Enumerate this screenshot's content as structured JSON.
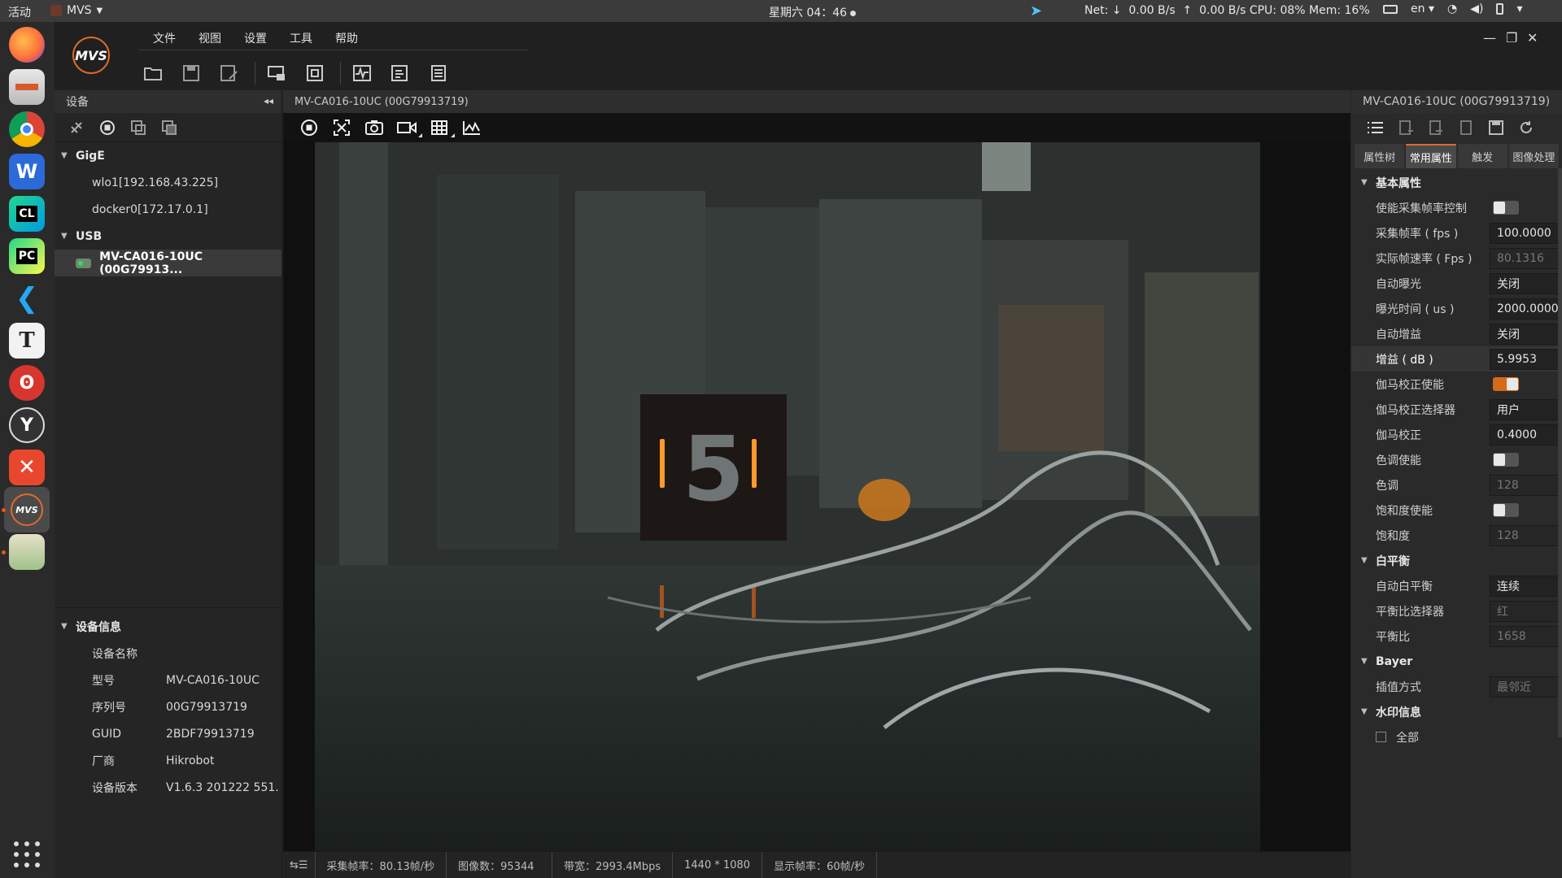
{
  "topbar": {
    "activities": "活动",
    "app_name": "MVS",
    "clock": "星期六 04：46",
    "net": "Net: ↓  0.00 B/s  ↑  0.00 B/s CPU: 08% Mem: 16%",
    "lang": "en"
  },
  "menu": [
    "文件",
    "视图",
    "设置",
    "工具",
    "帮助"
  ],
  "logo_text": "MVS",
  "left": {
    "title": "设备",
    "gige_label": "GigE",
    "gige_items": [
      "wlo1[192.168.43.225]",
      "docker0[172.17.0.1]"
    ],
    "usb_label": "USB",
    "usb_device": "MV-CA016-10UC (00G79913...",
    "info_title": "设备信息",
    "info": {
      "name_k": "设备名称",
      "model_k": "型号",
      "model_v": "MV-CA016-10UC",
      "serial_k": "序列号",
      "serial_v": "00G79913719",
      "guid_k": "GUID",
      "guid_v": "2BDF79913719",
      "vendor_k": "厂商",
      "vendor_v": "Hikrobot",
      "version_k": "设备版本",
      "version_v": "V1.6.3 201222 551..."
    }
  },
  "viewer": {
    "title": "MV-CA016-10UC (00G79913719)",
    "status": {
      "capture_fps": "采集帧率：80.13帧/秒",
      "image_count": "图像数：95344",
      "bandwidth": "带宽：2993.4Mbps",
      "resolution": "1440 * 1080",
      "display_fps": "显示帧率：60帧/秒"
    },
    "scene_digit": "5"
  },
  "right": {
    "title": "MV-CA016-10UC (00G79913719)",
    "tabs": [
      "属性树",
      "常用属性",
      "触发",
      "图像处理"
    ],
    "sec_basic": "基本属性",
    "sec_wb": "白平衡",
    "sec_bayer": "Bayer",
    "sec_wm": "水印信息",
    "p": {
      "fr_enable": "使能采集帧率控制",
      "fr": "采集帧率 ( fps )",
      "fr_v": "100.0000",
      "afr": "实际帧速率 ( Fps )",
      "afr_v": "80.1316",
      "ae": "自动曝光",
      "ae_v": "关闭",
      "et": "曝光时间 ( us )",
      "et_v": "2000.0000",
      "ag": "自动增益",
      "ag_v": "关闭",
      "gain": "增益 ( dB )",
      "gain_v": "5.9953",
      "gm_en": "伽马校正使能",
      "gm_sel": "伽马校正选择器",
      "gm_sel_v": "用户",
      "gm": "伽马校正",
      "gm_v": "0.4000",
      "hue_en": "色调使能",
      "hue": "色调",
      "hue_v": "128",
      "sat_en": "饱和度使能",
      "sat": "饱和度",
      "sat_v": "128",
      "awb": "自动白平衡",
      "awb_v": "连续",
      "bsel": "平衡比选择器",
      "bsel_v": "红",
      "bratio": "平衡比",
      "bratio_v": "1658",
      "interp": "插值方式",
      "interp_v": "最邻近",
      "all": "全部"
    }
  }
}
